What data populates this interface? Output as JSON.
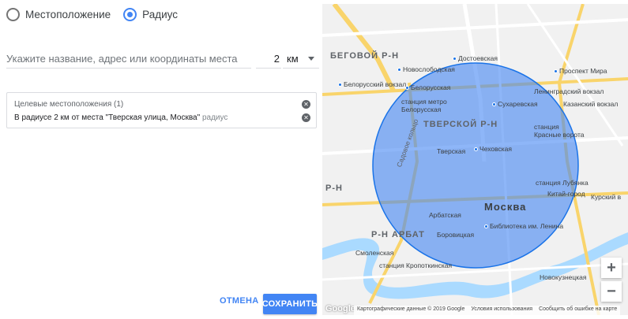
{
  "mode": {
    "options": [
      {
        "label": "Местоположение",
        "selected": false
      },
      {
        "label": "Радиус",
        "selected": true
      }
    ]
  },
  "search": {
    "placeholder": "Укажите название, адрес или координаты места",
    "value": ""
  },
  "distance": {
    "value": "2",
    "unit": "км"
  },
  "targets": {
    "header": "Целевые местоположения (1)",
    "items": [
      {
        "text": "В радиусе 2 км от места \"Тверская улица, Москва\"",
        "type": "радиус"
      }
    ]
  },
  "actions": {
    "cancel": "ОТМЕНА",
    "save": "СОХРАНИТЬ"
  },
  "map": {
    "labels": {
      "begovoy": "БЕГОВОЙ Р-Н",
      "tverskoy": "ТВЕРСКОЙ Р-Н",
      "moskva": "Москва",
      "rn_left": "Р-Н",
      "arbat": "Р-Н АРБАТ",
      "novoslobodskaya": "Новослободская",
      "dostoevskaya": "Достоевская",
      "belorussky": "Белорусский вокзал",
      "belorusskaya": "Белорусская",
      "metro_belorusskaya": "станция метро\nБелорусская",
      "prospekt_mira": "Проспект Мира",
      "leningradsky": "Ленинградский вокзал",
      "kazansky": "Казанский вокзал",
      "sukharevskaya": "Сухаревская",
      "krasnye_vorota": "станция\nКрасные ворота",
      "tverskaya": "Тверская",
      "chekhovskaya": "Чеховская",
      "sadovoe": "Садовое кольцо",
      "lubyanka": "станция Лубянка",
      "kitay_gorod": "Китай-город",
      "kursky": "Курский в",
      "arbatskaya": "Арбатская",
      "lenin_library": "Библиотека им. Ленина",
      "borovitskaya": "Боровицкая",
      "smolenskaya": "Смоленская",
      "kropotkinskaya": "станция Кропоткинская",
      "novokuznetskaya": "Новокузнецкая"
    },
    "footer": {
      "copyright": "Картографические данные © 2019 Google",
      "terms": "Условия использования",
      "report": "Сообщить об ошибке на карте"
    },
    "logo": "Google",
    "colors": {
      "circle_fill": "#4285f4",
      "circle_stroke": "#1a73e8",
      "road": "#f9d46b",
      "water": "#aadaff"
    }
  }
}
